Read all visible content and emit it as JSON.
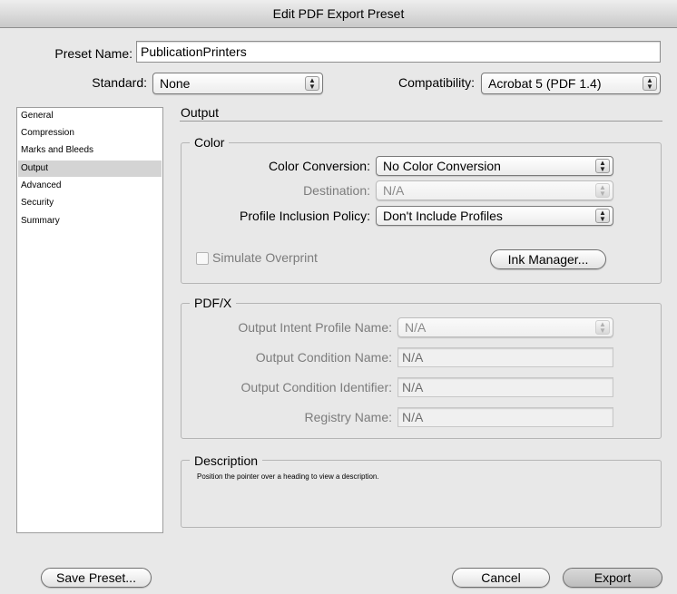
{
  "window": {
    "title": "Edit PDF Export Preset"
  },
  "preset": {
    "label": "Preset Name:",
    "value": "PublicationPrinters"
  },
  "standard": {
    "label": "Standard:",
    "value": "None"
  },
  "compatibility": {
    "label": "Compatibility:",
    "value": "Acrobat 5 (PDF 1.4)"
  },
  "sidebar": {
    "items": [
      {
        "label": "General"
      },
      {
        "label": "Compression"
      },
      {
        "label": "Marks and Bleeds"
      },
      {
        "label": "Output",
        "selected": true
      },
      {
        "label": "Advanced"
      },
      {
        "label": "Security"
      },
      {
        "label": "Summary"
      }
    ]
  },
  "panel": {
    "heading": "Output"
  },
  "color": {
    "title": "Color",
    "conversion_label": "Color Conversion:",
    "conversion_value": "No Color Conversion",
    "destination_label": "Destination:",
    "destination_value": "N/A",
    "profile_label": "Profile Inclusion Policy:",
    "profile_value": "Don't Include Profiles",
    "simulate_overprint_label": "Simulate Overprint",
    "simulate_overprint_checked": false,
    "ink_manager_label": "Ink Manager..."
  },
  "pdfx": {
    "title": "PDF/X",
    "intent_label": "Output Intent Profile Name:",
    "intent_value": "N/A",
    "condition_name_label": "Output Condition Name:",
    "condition_name_value": "N/A",
    "condition_id_label": "Output Condition Identifier:",
    "condition_id_value": "N/A",
    "registry_label": "Registry Name:",
    "registry_value": "N/A"
  },
  "description": {
    "title": "Description",
    "text": "Position the pointer over a heading to view a description."
  },
  "buttons": {
    "save_preset": "Save Preset...",
    "cancel": "Cancel",
    "export": "Export"
  },
  "colors": {
    "window_bg": "#e8e8e8",
    "selection": "#d4d4d4"
  }
}
